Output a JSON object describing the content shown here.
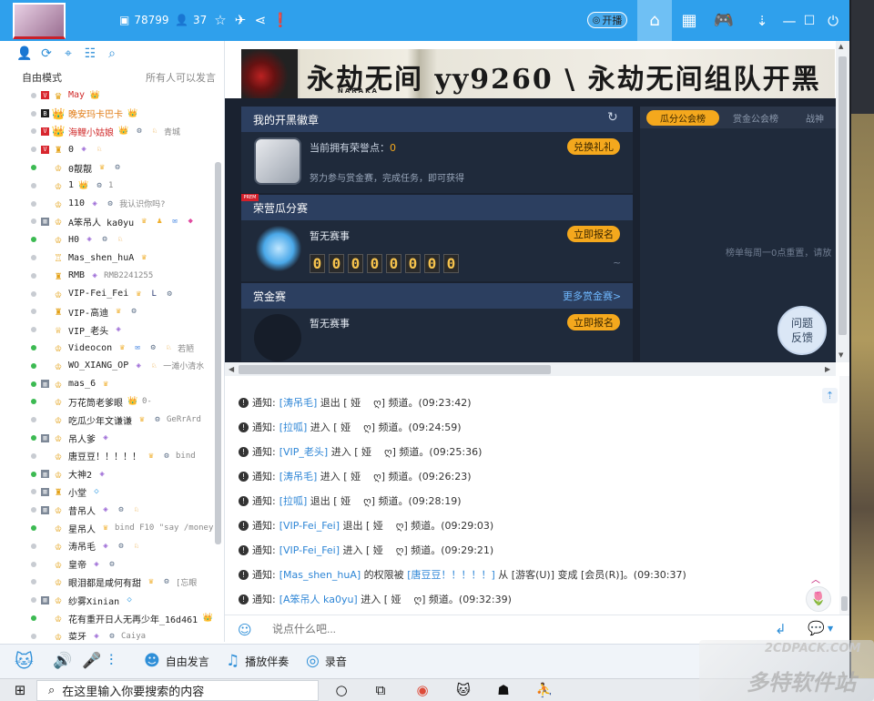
{
  "titlebar": {
    "stat_id": "78799",
    "stat_online": "37",
    "live_button": "开播",
    "icons": [
      "id-icon",
      "person-icon",
      "star-icon",
      "plane-icon",
      "share-icon",
      "info-icon"
    ],
    "nav_icons": [
      "home-icon",
      "grid-icon",
      "gamepad-icon",
      "minimize-icon",
      "maximize-icon",
      "power-icon"
    ]
  },
  "leftpanel": {
    "tools": [
      "add-user-icon",
      "refresh-icon",
      "location-icon",
      "list-icon",
      "search-icon"
    ],
    "mode_label": "自由模式",
    "mode_desc": "所有人可以发言",
    "users": [
      {
        "name": "May",
        "color": "#d02a2a",
        "dot": "s",
        "tag": "V",
        "role": "♛",
        "badges": [
          "👑"
        ],
        "extra": ""
      },
      {
        "name": "晚安玛卡巴卡",
        "color": "#e07a12",
        "dot": "s",
        "tag": "B",
        "role": "👑",
        "badges": [
          "👑"
        ],
        "extra": ""
      },
      {
        "name": "海鲤小姑娘",
        "color": "#d02a2a",
        "dot": "s",
        "tag": "V",
        "role": "👑",
        "badges": [
          "👑",
          "⚙",
          "♘"
        ],
        "extra": "青城"
      },
      {
        "name": "0",
        "color": "#222",
        "dot": "s",
        "tag": "V",
        "role": "♜",
        "badges": [
          "◈",
          "♘"
        ],
        "extra": ""
      },
      {
        "name": "0靓靓",
        "color": "#222",
        "dot": "g",
        "tag": "",
        "role": "♔",
        "badges": [
          "♛",
          "⚙"
        ],
        "extra": ""
      },
      {
        "name": "1",
        "color": "#222",
        "dot": "s",
        "tag": "",
        "role": "♔",
        "badges": [
          "👑",
          "⚙"
        ],
        "extra": "1"
      },
      {
        "name": "110",
        "color": "#222",
        "dot": "s",
        "tag": "",
        "role": "♔",
        "badges": [
          "◈",
          "⚙"
        ],
        "extra": "我认识你吗?"
      },
      {
        "name": "A笨吊人 ka0yu",
        "color": "#222",
        "dot": "s",
        "tag": "▥",
        "role": "♔",
        "badges": [
          "♛",
          "♟",
          "✉",
          "◆"
        ],
        "extra": ""
      },
      {
        "name": "H0",
        "color": "#222",
        "dot": "g",
        "tag": "",
        "role": "♔",
        "badges": [
          "◈",
          "⚙",
          "♘"
        ],
        "extra": ""
      },
      {
        "name": "Mas_shen_huA",
        "color": "#222",
        "dot": "s",
        "tag": "",
        "role": "♖",
        "badges": [
          "♛"
        ],
        "extra": ""
      },
      {
        "name": "RMB",
        "color": "#222",
        "dot": "s",
        "tag": "",
        "role": "♜",
        "badges": [
          "◈"
        ],
        "extra": "RMB2241255"
      },
      {
        "name": "VIP-Fei_Fei",
        "color": "#222",
        "dot": "s",
        "tag": "",
        "role": "♔",
        "badges": [
          "♛",
          "L",
          "⚙"
        ],
        "extra": ""
      },
      {
        "name": "VIP-高迪",
        "color": "#222",
        "dot": "s",
        "tag": "",
        "role": "♜",
        "badges": [
          "♛",
          "⚙"
        ],
        "extra": ""
      },
      {
        "name": "VIP_老头",
        "color": "#222",
        "dot": "s",
        "tag": "",
        "role": "♕",
        "badges": [
          "◈"
        ],
        "extra": ""
      },
      {
        "name": "Videocon",
        "color": "#222",
        "dot": "g",
        "tag": "",
        "role": "♔",
        "badges": [
          "♛",
          "✉",
          "⚙",
          "♘"
        ],
        "extra": "若陋"
      },
      {
        "name": "WO_XIANG_OP",
        "color": "#222",
        "dot": "g",
        "tag": "",
        "role": "♔",
        "badges": [
          "◈",
          "♘"
        ],
        "extra": "一滩小清水"
      },
      {
        "name": "mas_6",
        "color": "#222",
        "dot": "g",
        "tag": "▥",
        "role": "♔",
        "badges": [
          "♛"
        ],
        "extra": ""
      },
      {
        "name": "万花筒老爹眼",
        "color": "#222",
        "dot": "g",
        "tag": "",
        "role": "♔",
        "badges": [
          "👑"
        ],
        "extra": "0-"
      },
      {
        "name": "吃瓜少年文谦谦",
        "color": "#222",
        "dot": "s",
        "tag": "",
        "role": "♔",
        "badges": [
          "♛",
          "⚙"
        ],
        "extra": "GeRrArd"
      },
      {
        "name": "吊人爹",
        "color": "#222",
        "dot": "g",
        "tag": "▥",
        "role": "♔",
        "badges": [
          "◈"
        ],
        "extra": ""
      },
      {
        "name": "唐豆豆！！！！！",
        "color": "#222",
        "dot": "s",
        "tag": "",
        "role": "♔",
        "badges": [
          "♛",
          "⚙"
        ],
        "extra": "bind"
      },
      {
        "name": "大神2",
        "color": "#222",
        "dot": "g",
        "tag": "▥",
        "role": "♔",
        "badges": [
          "◈"
        ],
        "extra": ""
      },
      {
        "name": "小堂",
        "color": "#222",
        "dot": "s",
        "tag": "▥",
        "role": "♜",
        "badges": [
          "◇"
        ],
        "extra": ""
      },
      {
        "name": "昔吊人",
        "color": "#222",
        "dot": "s",
        "tag": "▥",
        "role": "♔",
        "badges": [
          "◈",
          "⚙",
          "♘"
        ],
        "extra": ""
      },
      {
        "name": "星吊人",
        "color": "#222",
        "dot": "g",
        "tag": "",
        "role": "♔",
        "badges": [
          "♛"
        ],
        "extra": "bind F10 \"say /money"
      },
      {
        "name": "涛吊毛",
        "color": "#222",
        "dot": "s",
        "tag": "",
        "role": "♔",
        "badges": [
          "◈",
          "⚙",
          "♘"
        ],
        "extra": ""
      },
      {
        "name": "皇帝",
        "color": "#222",
        "dot": "s",
        "tag": "",
        "role": "♔",
        "badges": [
          "◈",
          "⚙"
        ],
        "extra": ""
      },
      {
        "name": "眼泪都是咸何有甜",
        "color": "#222",
        "dot": "s",
        "tag": "",
        "role": "♔",
        "badges": [
          "♛",
          "⚙"
        ],
        "extra": "[忘眼"
      },
      {
        "name": "纱雾Xinian",
        "color": "#222",
        "dot": "s",
        "tag": "▥",
        "role": "♔",
        "badges": [
          "◇"
        ],
        "extra": ""
      },
      {
        "name": "花有重开日人无再少年_16d461",
        "color": "#222",
        "dot": "g",
        "tag": "",
        "role": "♔",
        "badges": [
          "👑"
        ],
        "extra": ""
      },
      {
        "name": "菜牙",
        "color": "#222",
        "dot": "s",
        "tag": "",
        "role": "♔",
        "badges": [
          "◈",
          "⚙"
        ],
        "extra": "Caiya"
      }
    ]
  },
  "banner": {
    "logo_text": "永劫无间",
    "logo_sub": "NARAKA",
    "text": "永劫无间 yy9260 \\ 永劫无间组队开黑"
  },
  "badge_panel": {
    "title": "我的开黑徽章",
    "points_label": "当前拥有荣誉点：",
    "points_value": "0",
    "exchange_button": "兑换礼礼",
    "hint": "努力参与赏金赛，完成任务，即可获得"
  },
  "melon_panel": {
    "tag": "PREM",
    "title": "荣营瓜分赛",
    "status": "暂无赛事",
    "signup_button": "立即报名",
    "digits": [
      "0",
      "0",
      "0",
      "0",
      "0",
      "0",
      "0",
      "0"
    ],
    "tilde": "~"
  },
  "bounty_panel": {
    "title": "赏金赛",
    "more_link": "更多赏金赛>",
    "status": "暂无赛事",
    "signup_button": "立即报名"
  },
  "rank_panel": {
    "tabs": [
      "瓜分公会榜",
      "赏金公会榜",
      "战神"
    ],
    "note": "榜单每周一0点重置，请放"
  },
  "feedback_button": {
    "line1": "问题",
    "line2": "反馈"
  },
  "chat": {
    "messages": [
      {
        "prefix": "通知:",
        "name": "[涛吊毛]",
        "rest": " 退出 [ 娅    ღ] 频道。(09:23:42)"
      },
      {
        "prefix": "通知:",
        "name": "[拉呱]",
        "rest": " 进入 [ 娅    ღ] 频道。(09:24:59)"
      },
      {
        "prefix": "通知:",
        "name": "[VIP_老头]",
        "rest": " 进入 [ 娅    ღ] 频道。(09:25:36)"
      },
      {
        "prefix": "通知:",
        "name": "[涛吊毛]",
        "rest": " 进入 [ 娅    ღ] 频道。(09:26:23)"
      },
      {
        "prefix": "通知:",
        "name": "[拉呱]",
        "rest": " 退出 [ 娅    ღ] 频道。(09:28:19)"
      },
      {
        "prefix": "通知:",
        "name": "[VIP-Fei_Fei]",
        "rest": " 退出 [ 娅    ღ] 频道。(09:29:03)"
      },
      {
        "prefix": "通知:",
        "name": "[VIP-Fei_Fei]",
        "rest": " 进入 [ 娅    ღ] 频道。(09:29:21)"
      },
      {
        "prefix": "通知:",
        "name": "[Mas_shen_huA]",
        "rest": " 的权限被 ",
        "name2": "[唐豆豆！！！！！]",
        "rest2": " 从 [游客(U)] 变成 [会员(R)]。(09:30:37)"
      },
      {
        "prefix": "通知:",
        "name": "[A笨吊人 ka0yu]",
        "rest": " 进入 [ 娅    ღ] 频道。(09:32:39)"
      }
    ],
    "input_placeholder": "说点什么吧..."
  },
  "bottom_toolbar": {
    "free_speak": "自由发言",
    "accompany": "播放伴奏",
    "record": "录音"
  },
  "taskbar": {
    "search_placeholder": "在这里输入你要搜索的内容"
  },
  "watermark": {
    "line1": "2CDPACK.COM",
    "line2": "多特软件站"
  },
  "colors": {
    "titlebar": "#2fa0ec",
    "accent": "#2f8fd8",
    "orange": "#f4a81d",
    "dark_panel": "#1f2a3b",
    "link": "#2e86d6"
  }
}
